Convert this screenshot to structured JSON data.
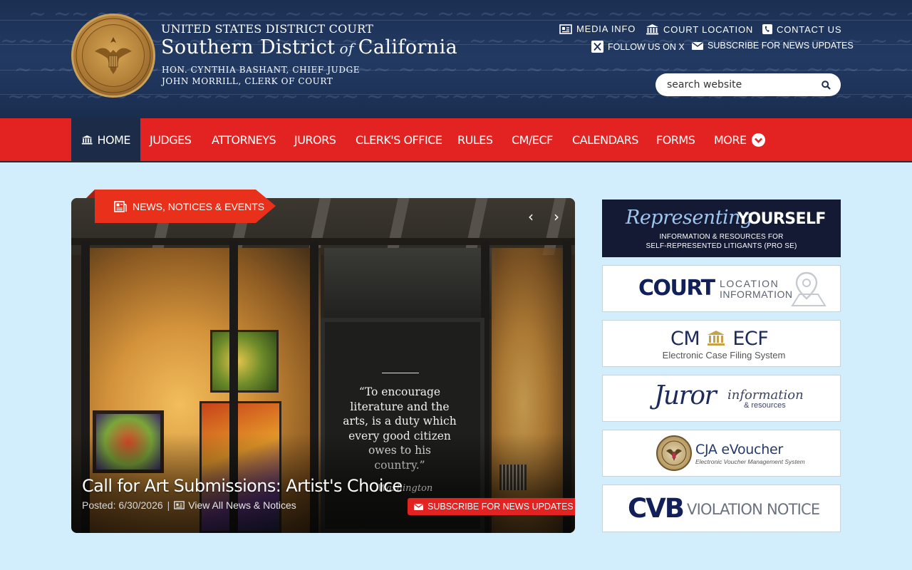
{
  "header": {
    "court_line1": "UNITED STATES DISTRICT COURT",
    "court_line2_a": "Southern District",
    "court_line2_of": "of",
    "court_line2_b": "California",
    "chief_judge": "HON. CYNTHIA BASHANT, CHIEF JUDGE",
    "clerk": "JOHN MORRILL, CLERK OF COURT",
    "seal_alt": "UNITED STATES DISTRICT COURT - SOUTHERN DISTRICT OF CALIFORNIA",
    "links": {
      "media_info": "MEDIA INFO",
      "court_location": "COURT LOCATION",
      "contact_us": "CONTACT US",
      "follow_x": "FOLLOW US ON X",
      "subscribe": "SUBSCRIBE FOR NEWS UPDATES"
    },
    "search_placeholder": "search website"
  },
  "nav": {
    "items": [
      {
        "label": "HOME",
        "icon": "courthouse-icon",
        "active": true
      },
      {
        "label": "JUDGES"
      },
      {
        "label": "ATTORNEYS"
      },
      {
        "label": "JURORS"
      },
      {
        "label": "CLERK'S OFFICE"
      },
      {
        "label": "RULES"
      },
      {
        "label": "CM/ECF"
      },
      {
        "label": "CALENDARS"
      },
      {
        "label": "FORMS"
      },
      {
        "label": "MORE",
        "icon": "chevron-down-circle-icon"
      }
    ]
  },
  "news": {
    "tag": "NEWS, NOTICES & EVENTS",
    "slide_title": "Call for Art Submissions: Artist's Choice",
    "posted": "Posted: 6/30/2026",
    "separator": "|",
    "view_all": "View All News & Notices",
    "subscribe": "SUBSCRIBE FOR NEWS UPDATES",
    "quote": "“To encourage literature and the arts, is a duty which every good citizen owes to his country.”",
    "quote_attribution": "Washington"
  },
  "sidebar": {
    "representing": {
      "script": "Representing",
      "bold": "YOURSELF",
      "sub1": "INFORMATION & RESOURCES FOR",
      "sub2": "SELF-REPRESENTED LITIGANTS (PRO SE)"
    },
    "court_location": {
      "big": "COURT",
      "small1": "LOCATION",
      "small2": "INFORMATION"
    },
    "cmecf": {
      "title_a": "CM",
      "title_b": "ECF",
      "sub": "Electronic Case Filing System"
    },
    "juror": {
      "big": "Juror",
      "info": "information",
      "res": "& resources"
    },
    "cja": {
      "title": "CJA eVoucher",
      "sub": "Electronic Voucher Management System"
    },
    "cvb": {
      "big": "CVB",
      "small": "VIOLATION NOTICE"
    }
  },
  "colors": {
    "header_bg": "#1c2f52",
    "nav_red": "#e32222",
    "nav_active": "#1c2b48",
    "page_bg": "#d2eefc",
    "news_tag": "#e8301a",
    "navy_text": "#12205a"
  }
}
